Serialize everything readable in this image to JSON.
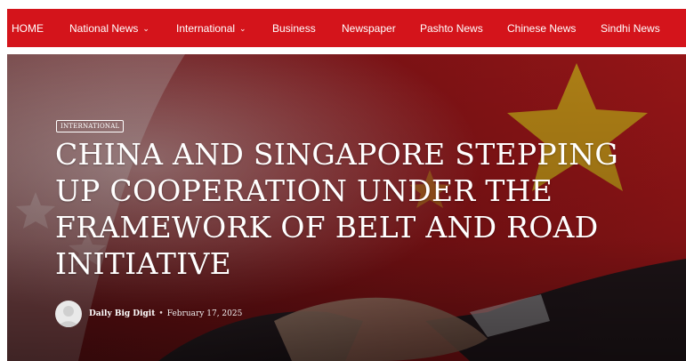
{
  "nav": {
    "items": [
      {
        "label": "HOME",
        "has_dropdown": false
      },
      {
        "label": "National News",
        "has_dropdown": true
      },
      {
        "label": "International",
        "has_dropdown": true
      },
      {
        "label": "Business",
        "has_dropdown": false
      },
      {
        "label": "Newspaper",
        "has_dropdown": false
      },
      {
        "label": "Pashto News",
        "has_dropdown": false
      },
      {
        "label": "Chinese News",
        "has_dropdown": false
      },
      {
        "label": "Sindhi News",
        "has_dropdown": false
      }
    ],
    "dropdown_icon": "chevron-down-icon",
    "background_color": "#d4141b",
    "text_color": "#ffffff"
  },
  "article": {
    "category": "INTERNATIONAL",
    "title": "CHINA AND SINGAPORE STEPPING UP COOPERATION UNDER THE FRAMEWORK OF BELT AND ROAD INITIATIVE",
    "author": "Daily Big Digit",
    "separator": "•",
    "date": "February 17, 2025",
    "avatar_icon": "user-avatar-icon"
  }
}
